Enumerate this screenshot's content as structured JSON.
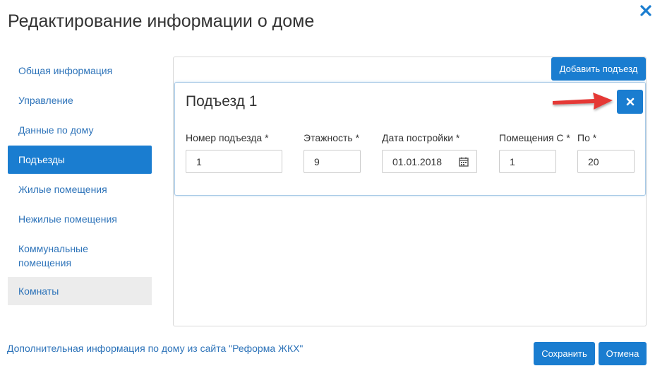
{
  "dialog": {
    "title": "Редактирование информации о доме"
  },
  "sidebar": {
    "items": [
      {
        "label": "Общая информация"
      },
      {
        "label": "Управление"
      },
      {
        "label": "Данные по дому"
      },
      {
        "label": "Подъезды"
      },
      {
        "label": "Жилые помещения"
      },
      {
        "label": "Нежилые помещения"
      },
      {
        "label": "Коммунальные помещения"
      },
      {
        "label": "Комнаты"
      }
    ]
  },
  "main": {
    "add_button": "Добавить подъезд",
    "entrance": {
      "title": "Подъезд 1",
      "fields": {
        "number": {
          "label": "Номер подъезда *",
          "value": "1"
        },
        "floors": {
          "label": "Этажность *",
          "value": "9"
        },
        "build_date": {
          "label": "Дата постройки *",
          "value": "01.01.2018"
        },
        "rooms_from": {
          "label": "Помещения С *",
          "value": "1"
        },
        "rooms_to": {
          "label": "По *",
          "value": "20"
        }
      }
    }
  },
  "footer": {
    "info_link": "Дополнительная информация по дому из сайта \"Реформа ЖКХ\"",
    "save": "Сохранить",
    "cancel": "Отмена"
  },
  "colors": {
    "accent": "#1a7dd0",
    "link": "#2d73b9",
    "arrow": "#e53935"
  }
}
